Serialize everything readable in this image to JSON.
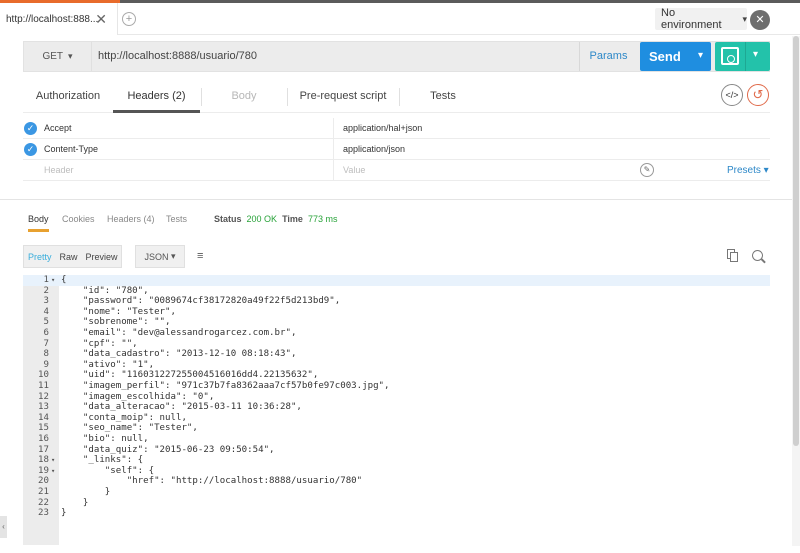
{
  "colors": {
    "send": "#1f8ee0",
    "save": "#23c2aa",
    "link": "#2d88c8",
    "status_ok": "#29a33a",
    "tab_accent": "#e8a130"
  },
  "tab": {
    "title": "http://localhost:888...",
    "close": "✕",
    "add": "+"
  },
  "env": {
    "label": "No environment",
    "chevron": "⌄",
    "eye": "👁"
  },
  "request": {
    "method": "GET",
    "url": "http://localhost:8888/usuario/780",
    "params_label": "Params",
    "send_label": "Send"
  },
  "subtabs": [
    {
      "label": "Authorization"
    },
    {
      "label": "Headers (2)"
    },
    {
      "label": "Body"
    },
    {
      "label": "Pre-request script"
    },
    {
      "label": "Tests"
    }
  ],
  "headers": [
    {
      "key": "Accept",
      "value": "application/hal+json"
    },
    {
      "key": "Content-Type",
      "value": "application/json"
    }
  ],
  "header_placeholder": {
    "key": "Header",
    "value": "Value"
  },
  "presets_label": "Presets",
  "response": {
    "tabs": [
      "Body",
      "Cookies",
      "Headers (4)",
      "Tests"
    ],
    "status_label": "Status",
    "status_value": "200 OK",
    "time_label": "Time",
    "time_value": "773 ms",
    "view_modes": [
      "Pretty",
      "Raw",
      "Preview"
    ],
    "format": "JSON"
  },
  "code_lines": [
    {
      "n": "1",
      "fold": "▾",
      "text": "{"
    },
    {
      "n": "2",
      "fold": "",
      "text": "    \"id\": \"780\","
    },
    {
      "n": "3",
      "fold": "",
      "text": "    \"password\": \"0089674cf38172820a49f22f5d213bd9\","
    },
    {
      "n": "4",
      "fold": "",
      "text": "    \"nome\": \"Tester\","
    },
    {
      "n": "5",
      "fold": "",
      "text": "    \"sobrenome\": \"\","
    },
    {
      "n": "6",
      "fold": "",
      "text": "    \"email\": \"dev@alessandrogarcez.com.br\","
    },
    {
      "n": "7",
      "fold": "",
      "text": "    \"cpf\": \"\","
    },
    {
      "n": "8",
      "fold": "",
      "text": "    \"data_cadastro\": \"2013-12-10 08:18:43\","
    },
    {
      "n": "9",
      "fold": "",
      "text": "    \"ativo\": \"1\","
    },
    {
      "n": "10",
      "fold": "",
      "text": "    \"uid\": \"116031227255004516016dd4.22135632\","
    },
    {
      "n": "11",
      "fold": "",
      "text": "    \"imagem_perfil\": \"971c37b7fa8362aaa7cf57b0fe97c003.jpg\","
    },
    {
      "n": "12",
      "fold": "",
      "text": "    \"imagem_escolhida\": \"0\","
    },
    {
      "n": "13",
      "fold": "",
      "text": "    \"data_alteracao\": \"2015-03-11 10:36:28\","
    },
    {
      "n": "14",
      "fold": "",
      "text": "    \"conta_moip\": null,"
    },
    {
      "n": "15",
      "fold": "",
      "text": "    \"seo_name\": \"Tester\","
    },
    {
      "n": "16",
      "fold": "",
      "text": "    \"bio\": null,"
    },
    {
      "n": "17",
      "fold": "",
      "text": "    \"data_quiz\": \"2015-06-23 09:50:54\","
    },
    {
      "n": "18",
      "fold": "▾",
      "text": "    \"_links\": {"
    },
    {
      "n": "19",
      "fold": "▾",
      "text": "        \"self\": {"
    },
    {
      "n": "20",
      "fold": "",
      "text": "            \"href\": \"http://localhost:8888/usuario/780\""
    },
    {
      "n": "21",
      "fold": "",
      "text": "        }"
    },
    {
      "n": "22",
      "fold": "",
      "text": "    }"
    },
    {
      "n": "23",
      "fold": "",
      "text": "}"
    }
  ]
}
